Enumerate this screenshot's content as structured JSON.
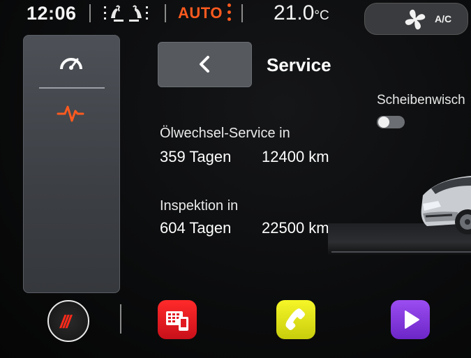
{
  "status_bar": {
    "time": "12:06",
    "climate_mode": "AUTO",
    "temperature_value": "21.0",
    "temperature_unit": "°C",
    "ac_label": "A/C"
  },
  "left_panel": {
    "items": [
      {
        "icon": "gauge-icon",
        "active": false
      },
      {
        "icon": "pulse-icon",
        "active": true
      }
    ]
  },
  "header": {
    "title": "Service"
  },
  "wiper": {
    "label": "Scheibenwisch",
    "enabled": false
  },
  "service": {
    "oil": {
      "label": "Ölwechsel-Service in",
      "days": "359 Tagen",
      "km": "12400 km"
    },
    "inspection": {
      "label": "Inspektion in",
      "days": "604 Tagen",
      "km": "22500 km"
    }
  },
  "dock": {
    "menu_label": "///",
    "apps": [
      {
        "icon": "dialpad-icon",
        "color": "#e11a22"
      },
      {
        "icon": "phone-icon",
        "color": "#e2e41a"
      },
      {
        "icon": "media-play-icon",
        "color": "#8a3ce6"
      }
    ]
  },
  "colors": {
    "accent": "#ff5a1f",
    "background": "#0b0c0d"
  }
}
